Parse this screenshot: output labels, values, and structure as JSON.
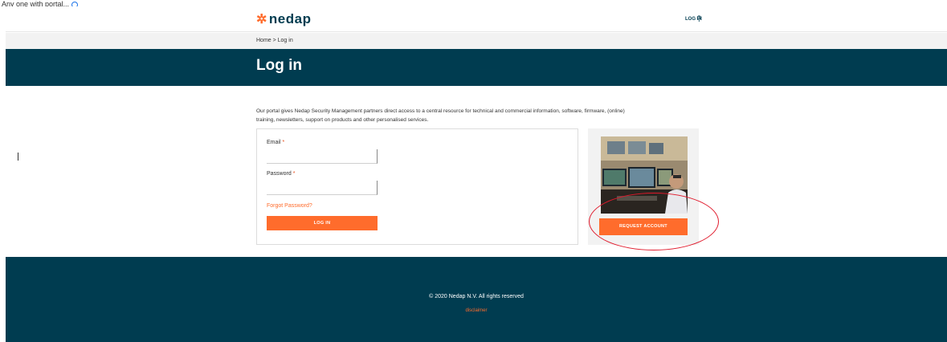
{
  "caption": {
    "text": "Any one with portal..."
  },
  "header": {
    "logo_text": "nedap",
    "logo_mark": "✲",
    "login_label": "LOG IN",
    "search_glyph": "⚲"
  },
  "breadcrumb": {
    "text": "Home > Log in"
  },
  "hero": {
    "title": "Log in"
  },
  "main": {
    "intro_line1": "Our portal gives Nedap Security Management partners direct access to a central resource for technical and commercial information, software, firmware, (online)",
    "intro_line2": "training, newsletters, support on products and other personalised services."
  },
  "login_form": {
    "email_label": "Email",
    "email_required": "*",
    "email_value": "",
    "password_label": "Password",
    "password_required": "*",
    "password_value": "",
    "forgot_label": "Forgot Password?",
    "submit_label": "LOG IN"
  },
  "side": {
    "request_label": "REQUEST ACCOUNT"
  },
  "footer": {
    "copyright": "© 2020 Nedap N.V. All rights reserved",
    "disclaimer": "disclaimer"
  },
  "colors": {
    "brand_dark": "#003c50",
    "accent": "#ff6c2c",
    "annotation_red": "#e0192b"
  }
}
